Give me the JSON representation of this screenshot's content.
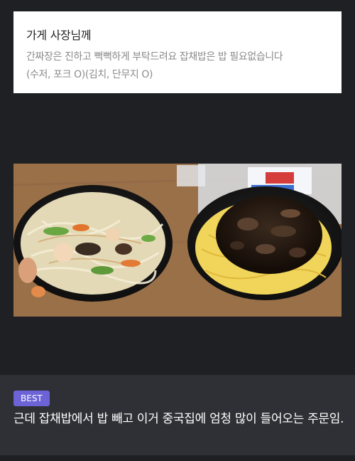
{
  "note": {
    "title": "가게 사장님께",
    "line1": "간짜장은 진하고 뻑뻑하게 부탁드려요 잡채밥은 밥 필요없습니다",
    "line2": "(수저, 포크 O)(김치, 단무지 O)"
  },
  "photo": {
    "subject": "food-photo-japchae-and-jjajang",
    "colors": {
      "table": "#9b6f47",
      "bowl": "#1a1a1a",
      "noodles": "#f0d55a",
      "sauce": "#241810"
    }
  },
  "comment": {
    "badge": "BEST",
    "text": "근데 잡채밥에서 밥 빼고 이거 중국집에 엄청 많이 들어오는 주문임."
  },
  "colors": {
    "background": "#1f2024",
    "badge": "#6b63d6",
    "bar": "#2f3036"
  }
}
